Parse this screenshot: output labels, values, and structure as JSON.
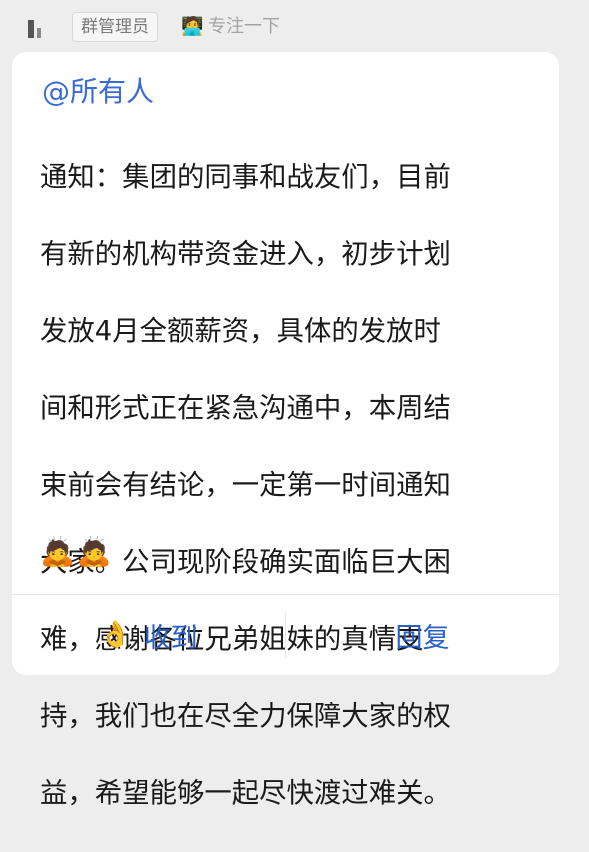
{
  "header": {
    "role_tag": "群管理员",
    "status_emoji": "🧑‍💻",
    "status_text": "专注一下"
  },
  "message": {
    "mention": "@所有人",
    "lines": [
      "通知：集团的同事和战友们，目前",
      "有新的机构带资金进入，初步计划",
      "发放4月全额薪资，具体的发放时",
      "间和形式正在紧急沟通中，本周结",
      "束前会有结论，一定第一时间通知",
      "大家。公司现阶段确实面临巨大困",
      "难，感谢各位兄弟姐妹的真情支",
      "持，我们也在尽全力保障大家的权",
      "益，希望能够一起尽快渡过难关。"
    ],
    "emojis": "🙇🙇"
  },
  "actions": {
    "received_icon": "👌",
    "received_label": "收到",
    "reply_label": "回复"
  },
  "colors": {
    "background": "#ededed",
    "card": "#ffffff",
    "mention": "#3a6bd5",
    "action_text": "#2a5fc8"
  },
  "icons": {
    "sender": "signal-bars-avatar-icon",
    "status": "person-at-laptop-icon",
    "received": "ok-hand-icon"
  }
}
